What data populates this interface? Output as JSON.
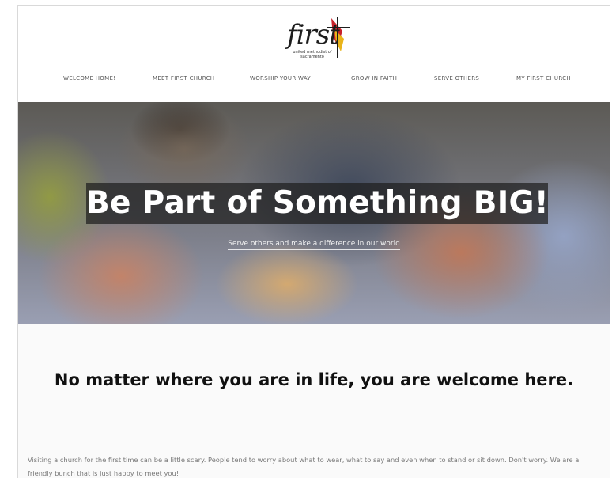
{
  "logo": {
    "word": "first",
    "subtitle": "united methodist of sacramento"
  },
  "nav": {
    "items": [
      {
        "label": "WELCOME HOME!"
      },
      {
        "label": "MEET FIRST CHURCH"
      },
      {
        "label": "WORSHIP YOUR WAY"
      },
      {
        "label": "GROW IN FAITH"
      },
      {
        "label": "SERVE OTHERS"
      },
      {
        "label": "MY FIRST CHURCH"
      }
    ]
  },
  "hero": {
    "title": "Be Part of Something BIG!",
    "subtitle": "Serve others and make a difference in our world"
  },
  "content": {
    "heading": "No matter where you are in life, you are welcome here.",
    "paragraph": "Visiting a church for the first time can be a little scary. People tend to worry about what to wear, what to say and even when to stand or sit down. Don't worry. We are a friendly bunch that is just happy to meet you!"
  },
  "colors": {
    "logo_red": "#c8202a",
    "logo_yellow": "#e9b41a",
    "nav_text": "#555555",
    "heading": "#111111",
    "body_text": "#777777"
  }
}
